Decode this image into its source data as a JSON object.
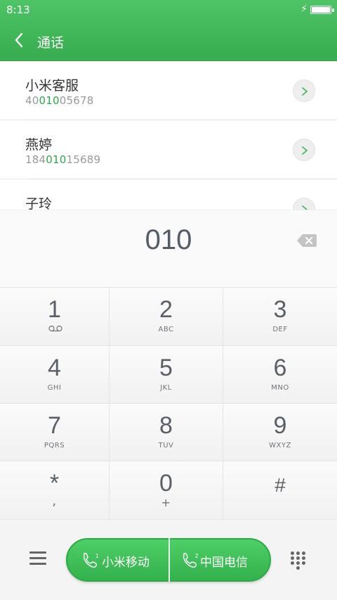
{
  "status": {
    "time": "8:13"
  },
  "header": {
    "title": "通话"
  },
  "contacts": [
    {
      "name": "小米客服",
      "num_pre": "40",
      "num_hl": "010",
      "num_post": "05678"
    },
    {
      "name": "燕婷",
      "num_pre": "184",
      "num_hl": "010",
      "num_post": "15689"
    },
    {
      "name": "子玲",
      "num_pre": "",
      "num_hl": "",
      "num_post": ""
    }
  ],
  "dial": {
    "input": "010"
  },
  "keys": [
    {
      "digit": "1",
      "letters": ""
    },
    {
      "digit": "2",
      "letters": "ABC"
    },
    {
      "digit": "3",
      "letters": "DEF"
    },
    {
      "digit": "4",
      "letters": "GHI"
    },
    {
      "digit": "5",
      "letters": "JKL"
    },
    {
      "digit": "6",
      "letters": "MNO"
    },
    {
      "digit": "7",
      "letters": "PQRS"
    },
    {
      "digit": "8",
      "letters": "TUV"
    },
    {
      "digit": "9",
      "letters": "WXYZ"
    },
    {
      "digit": "*",
      "letters": ","
    },
    {
      "digit": "0",
      "letters": "+"
    },
    {
      "digit": "#",
      "letters": ""
    }
  ],
  "calls": {
    "sim1_label": "小米移动",
    "sim1_index": "1",
    "sim2_label": "中国电信",
    "sim2_index": "2"
  },
  "icons": {
    "back": "back-arrow-icon",
    "charging": "lightning-icon",
    "battery": "battery-icon",
    "backspace": "backspace-icon",
    "voicemail": "voicemail-icon",
    "menu": "menu-icon",
    "keypad": "dialpad-icon",
    "phone": "phone-icon"
  },
  "colors": {
    "accent": "#36ac4f",
    "highlight": "#2ea84a"
  }
}
